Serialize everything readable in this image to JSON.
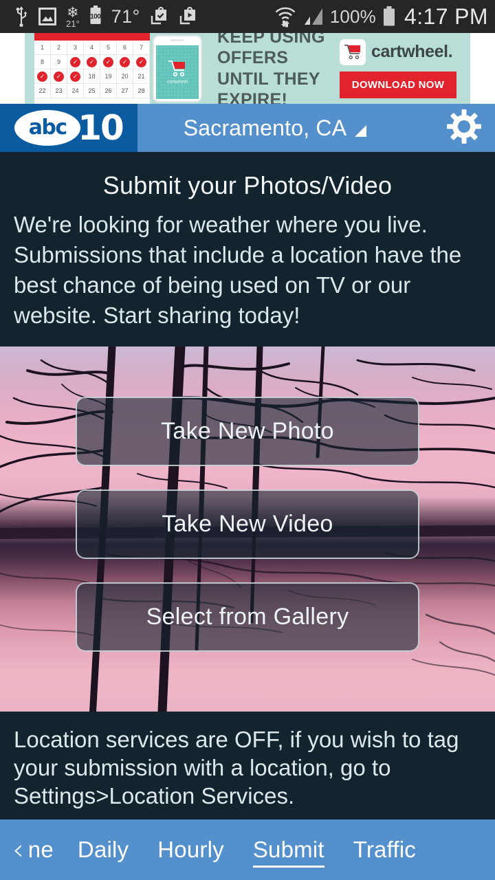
{
  "statusbar": {
    "icons": [
      "usb-icon",
      "gallery-image-icon",
      "snowflake-icon",
      "battery-saver-icon",
      "play-store-installed-icon",
      "play-store-update-icon",
      "wifi-icon",
      "cell-signal-icon"
    ],
    "snow_temp": "21",
    "degree_symbol": "°",
    "battery_saver_level": "100",
    "temperature": "71°",
    "battery_percent": "100%",
    "time": "4:17 PM"
  },
  "ad": {
    "name": "cartwheel-ad-banner",
    "headline_line1": "KEEP USING OFFERS",
    "headline_line2": "UNTIL THEY EXPIRE!",
    "brand": "cartwheel.",
    "cta": "DOWNLOAD NOW",
    "phone_caption": "cartwheel",
    "calendar_days": [
      "1",
      "2",
      "3",
      "4",
      "5",
      "6",
      "7",
      "8",
      "9",
      "10",
      "11",
      "12",
      "13",
      "14",
      "15",
      "16",
      "17",
      "18",
      "19",
      "20",
      "21",
      "22",
      "23",
      "24",
      "25",
      "26",
      "27",
      "28"
    ],
    "calendar_checked": [
      "10",
      "11",
      "12",
      "13",
      "14",
      "15",
      "16",
      "17"
    ],
    "colors": {
      "background": "#b9ded7",
      "accent_red": "#e0232c",
      "text": "#4d5b5c"
    }
  },
  "header": {
    "logo_abc": "abc",
    "logo_channel": "10",
    "location": "Sacramento, CA",
    "settings_icon": "gear-icon",
    "colors": {
      "bar": "#5490cc",
      "logo_bg": "#0b5ba1"
    }
  },
  "main": {
    "title": "Submit your Photos/Video",
    "description": "We're looking for weather where you live. Submissions that include a location have the best chance of being used on TV or our website. Start sharing today!",
    "buttons": [
      {
        "label": "Take New Photo",
        "name": "take-new-photo-button"
      },
      {
        "label": "Take New Video",
        "name": "take-new-video-button"
      },
      {
        "label": "Select from Gallery",
        "name": "select-from-gallery-button"
      }
    ],
    "location_notice": "Location services are OFF, if you wish to tag your submission with a location, go to Settings>Location Services.",
    "background_colors": {
      "panel": "#13242f",
      "sky_pink": "#eeb2c8",
      "sky_lavender": "#cbb8d6"
    }
  },
  "nav": {
    "back_chevron": "‹",
    "items": [
      {
        "label": "ne",
        "name": "nav-item-home",
        "active": false,
        "truncated": true
      },
      {
        "label": "Daily",
        "name": "nav-item-daily",
        "active": false
      },
      {
        "label": "Hourly",
        "name": "nav-item-hourly",
        "active": false
      },
      {
        "label": "Submit",
        "name": "nav-item-submit",
        "active": true
      },
      {
        "label": "Traffic",
        "name": "nav-item-traffic",
        "active": false
      }
    ]
  }
}
